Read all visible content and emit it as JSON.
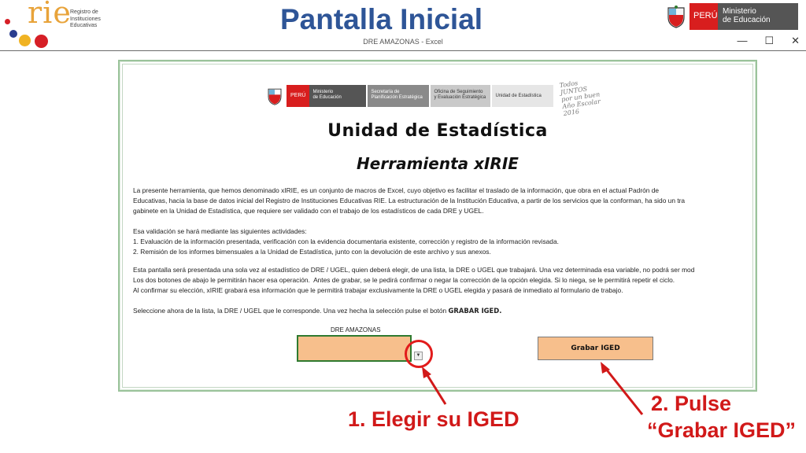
{
  "header": {
    "rie_word": "rie",
    "rie_subtitle": "Registro de\nInstituciones\nEducativas",
    "title": "Pantalla Inicial",
    "window_title": "DRE AMAZONAS - Excel",
    "ministry_country": "PERÚ",
    "ministry_name": "Ministerio\nde Educación",
    "window_controls": {
      "minimize": "—",
      "maximize": "☐",
      "close": "✕"
    }
  },
  "sheet": {
    "logos": {
      "peru": "PERÚ",
      "ministerio": "Ministerio\nde Educación",
      "secretaria": "Secretaría de\nPlanificación Estratégica",
      "oficina": "Oficina de Seguimiento\ny Evaluación Estratégica",
      "unidad": "Unidad de Estadística",
      "slogan": "Todos JUNTOS\npor un buen\nAño Escolar 2016"
    },
    "title": "Unidad de Estadística",
    "subtitle": "Herramienta xIRIE",
    "paragraph1": "La presente herramienta, que hemos denominado xIRIE, es un conjunto de macros de Excel, cuyo objetivo es facilitar el traslado de la información, que obra en el actual Padrón de\nEducativas, hacia la base de datos inicial del Registro de Instituciones Educativas RIE. La estructuración de la Institución Educativa, a partir de los servicios que la conforman, ha sido un tra\ngabinete en la Unidad de Estadística, que requiere ser validado con el trabajo de los estadísticos de cada DRE y UGEL.",
    "paragraph2": "Esa validación se hará mediante las siguientes actividades:\n1. Evaluación de la información presentada, verificación con la evidencia documentaria existente, corrección y registro de la información revisada.\n2. Remisión de los informes bimensuales a la Unidad de Estadística, junto con la devolución de este archivo y sus anexos.",
    "paragraph3": "Esta pantalla será presentada una sola vez al estadístico de DRE / UGEL, quien deberá elegir, de una lista, la DRE o UGEL que trabajará. Una vez determinada esa variable, no podrá ser mod\nLos dos botones de abajo le permitirán hacer esa operación.  Antes de grabar, se le pedirá confirmar o negar la corrección de la opción elegida. Si lo niega, se le permitirá repetir el ciclo.\nAl confirmar su elección, xIRIE grabará esa información que le permitirá trabajar exclusivamente la DRE o UGEL elegida y pasará de inmediato al formulario de trabajo.",
    "paragraph4_text": "Seleccione ahora de la lista, la DRE / UGEL que le corresponde. Una vez hecha la selección pulse el botón ",
    "paragraph4_bold": "GRABAR IGED.",
    "select_label": "DRE AMAZONAS",
    "select_value": "",
    "dropdown_glyph": "▼",
    "grabar_label": "Grabar IGED"
  },
  "annotations": {
    "step1": "1. Elegir su IGED",
    "step2_line1": "2. Pulse",
    "step2_line2": "“Grabar IGED”",
    "color": "#d11919"
  }
}
